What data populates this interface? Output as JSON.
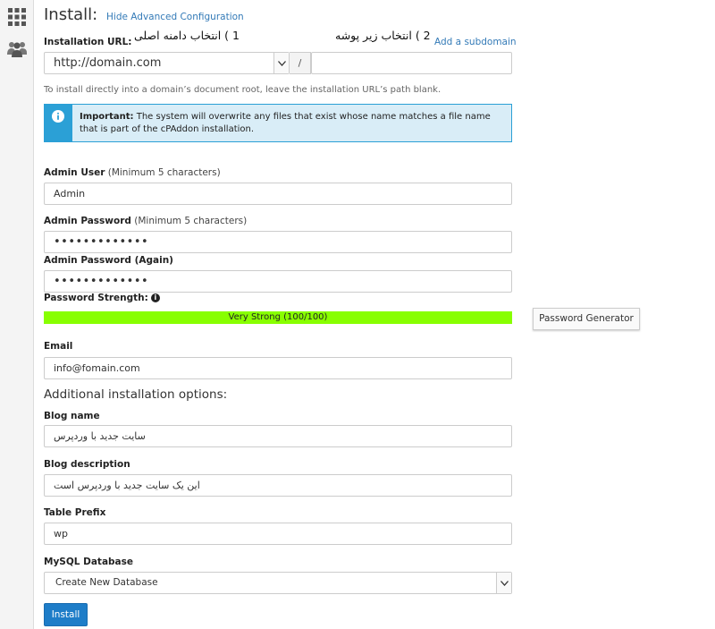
{
  "page": {
    "title": "Install:",
    "advanced_link": "Hide Advanced Configuration"
  },
  "sidebar": {
    "icons": [
      "grid-icon",
      "users-icon"
    ]
  },
  "url": {
    "label": "Installation URL:",
    "annotation_1": "1 ) انتخاب دامنه اصلی",
    "annotation_2": "2 ) انتخاب زیر پوشه",
    "subdomain_link": "Add a subdomain",
    "domain_value": "http://domain.com",
    "separator": "/",
    "path_value": "",
    "help": "To install directly into a domain’s document root, leave the installation URL’s path blank."
  },
  "alert": {
    "strong": "Important:",
    "text": " The system will overwrite any files that exist whose name matches a file name that is part of the cPAddon installation.",
    "icon": "info-icon"
  },
  "admin_user": {
    "label": "Admin User",
    "hint": " (Minimum 5 characters)",
    "value": "Admin"
  },
  "admin_password": {
    "label": "Admin Password",
    "hint": " (Minimum 5 characters)",
    "value": "•••••••••••••"
  },
  "admin_password_again": {
    "label": "Admin Password (Again)",
    "value": "•••••••••••••"
  },
  "strength": {
    "label": "Password Strength:",
    "text": "Very Strong (100/100)",
    "score": 100,
    "color": "#88ff00"
  },
  "password_generator": {
    "label": "Password Generator"
  },
  "email": {
    "label": "Email",
    "value": "info@fomain.com"
  },
  "additional": {
    "heading": "Additional installation options:"
  },
  "blog_name": {
    "label": "Blog name",
    "value": "سایت جدید با وردپرس"
  },
  "blog_description": {
    "label": "Blog description",
    "value": "این یک سایت جدید با وردپرس است"
  },
  "table_prefix": {
    "label": "Table Prefix",
    "value": "wp"
  },
  "mysql_db": {
    "label": "MySQL Database",
    "value": "Create New Database"
  },
  "install_button": {
    "label": "Install"
  },
  "colors": {
    "accent": "#337ab7",
    "alert_border": "#2ba0d6",
    "alert_bg": "#d9edf7",
    "button": "#1e7dc8"
  }
}
